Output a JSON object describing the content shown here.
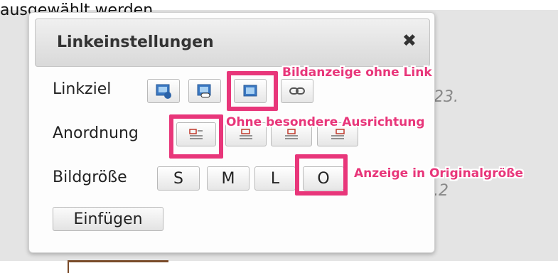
{
  "background": {
    "top_text": "ausgewählt werden.",
    "digits_1": "23.",
    "digits_2": ".2"
  },
  "dialog": {
    "title": "Linkeinstellungen",
    "close_symbol": "✖",
    "rows": {
      "linkziel_label": "Linkziel",
      "anordnung_label": "Anordnung",
      "bildgroesse_label": "Bildgröße"
    },
    "size_buttons": [
      "S",
      "M",
      "L",
      "O"
    ],
    "insert_label": "Einfügen"
  },
  "annotations": {
    "a1": "Bildanzeige ohne Link",
    "a2": "Ohne besondere Ausrichtung",
    "a3": "Anzeige in Originalgröße"
  },
  "colors": {
    "highlight": "#e8367a",
    "icon_blue": "#3a78c3"
  },
  "icons": {
    "linkziel": [
      "image-link-icon",
      "image-link-chain-icon",
      "image-no-link-icon",
      "link-chain-icon"
    ],
    "anordnung": [
      "align-none-icon",
      "align-left-icon",
      "align-center-icon",
      "align-right-icon"
    ]
  }
}
